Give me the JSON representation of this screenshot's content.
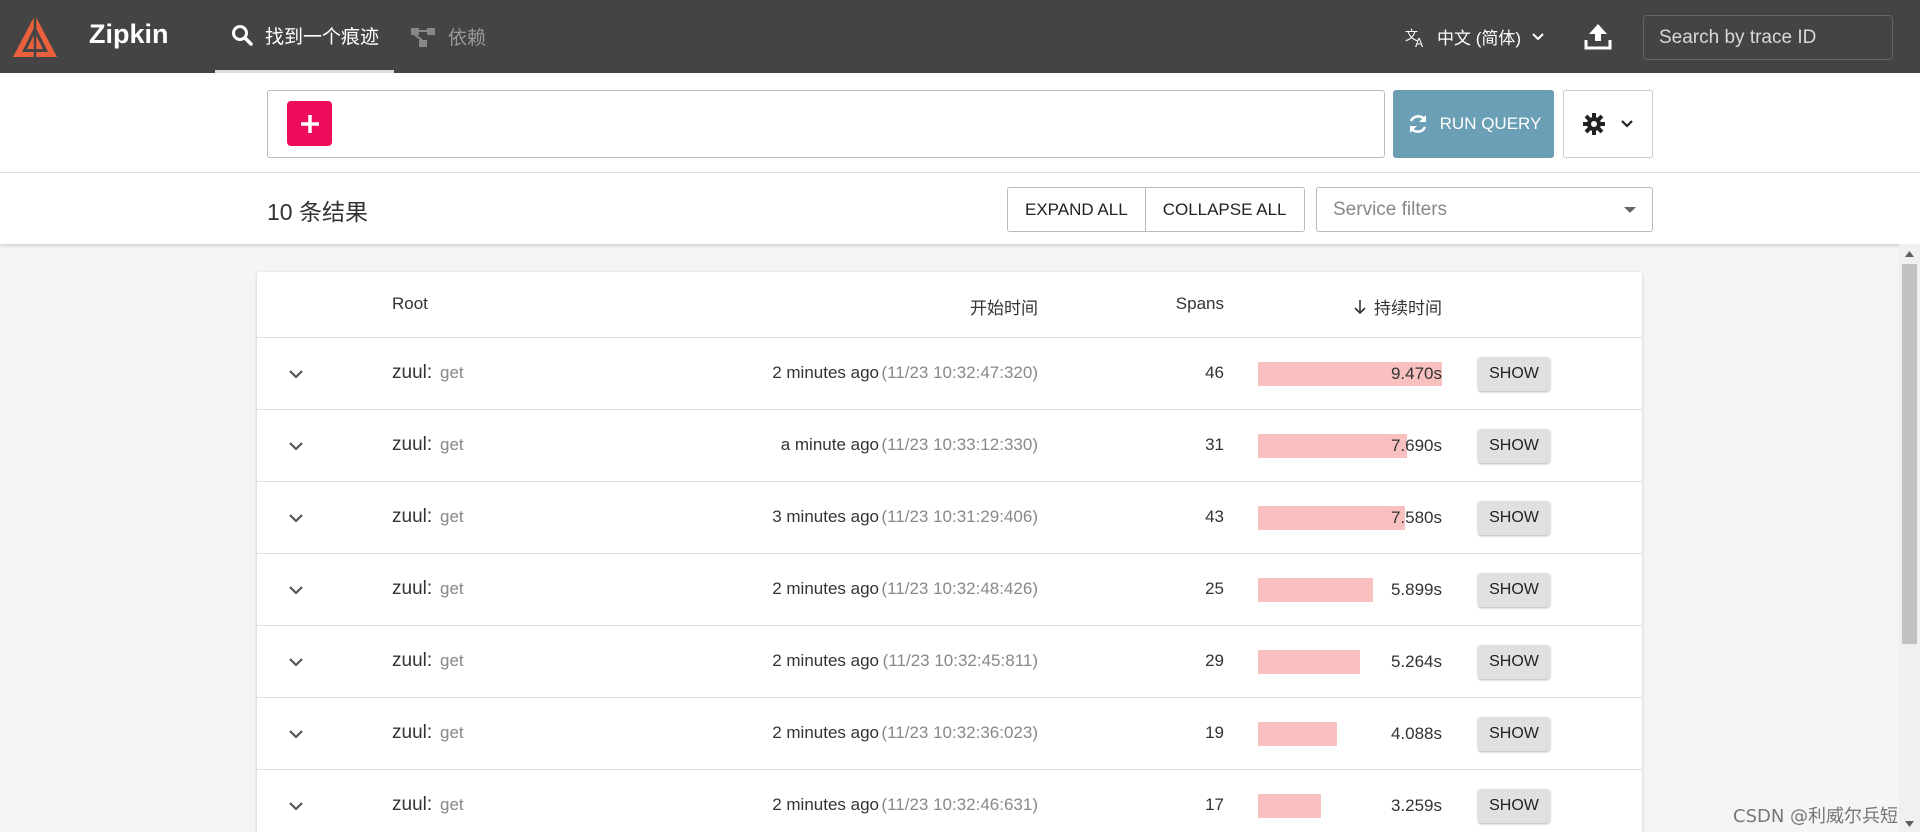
{
  "app": {
    "brand": "Zipkin"
  },
  "nav": {
    "tabs": [
      {
        "label": "找到一个痕迹",
        "icon": "search-icon",
        "active": true
      },
      {
        "label": "依赖",
        "icon": "dependencies-icon",
        "active": false
      }
    ],
    "language": "中文 (简体)",
    "trace_search_placeholder": "Search by trace ID"
  },
  "query": {
    "run_label": "RUN QUERY"
  },
  "results": {
    "count_label": "10 条结果",
    "expand_all": "EXPAND ALL",
    "collapse_all": "COLLAPSE ALL",
    "service_filter_placeholder": "Service filters"
  },
  "table": {
    "headers": {
      "root": "Root",
      "start_time": "开始时间",
      "spans": "Spans",
      "duration": "持续时间"
    },
    "show_label": "SHOW",
    "rows": [
      {
        "service": "zuul:",
        "operation": "get",
        "relative": "2 minutes ago",
        "absolute": "(11/23 10:32:47:320)",
        "spans": "46",
        "duration": "9.470s",
        "duration_ratio": 1.0
      },
      {
        "service": "zuul:",
        "operation": "get",
        "relative": "a minute ago",
        "absolute": "(11/23 10:33:12:330)",
        "spans": "31",
        "duration": "7.690s",
        "duration_ratio": 0.812
      },
      {
        "service": "zuul:",
        "operation": "get",
        "relative": "3 minutes ago",
        "absolute": "(11/23 10:31:29:406)",
        "spans": "43",
        "duration": "7.580s",
        "duration_ratio": 0.8
      },
      {
        "service": "zuul:",
        "operation": "get",
        "relative": "2 minutes ago",
        "absolute": "(11/23 10:32:48:426)",
        "spans": "25",
        "duration": "5.899s",
        "duration_ratio": 0.623
      },
      {
        "service": "zuul:",
        "operation": "get",
        "relative": "2 minutes ago",
        "absolute": "(11/23 10:32:45:811)",
        "spans": "29",
        "duration": "5.264s",
        "duration_ratio": 0.556
      },
      {
        "service": "zuul:",
        "operation": "get",
        "relative": "2 minutes ago",
        "absolute": "(11/23 10:32:36:023)",
        "spans": "19",
        "duration": "4.088s",
        "duration_ratio": 0.432
      },
      {
        "service": "zuul:",
        "operation": "get",
        "relative": "2 minutes ago",
        "absolute": "(11/23 10:32:46:631)",
        "spans": "17",
        "duration": "3.259s",
        "duration_ratio": 0.344
      }
    ]
  },
  "colors": {
    "topbar": "#444444",
    "add_button": "#ed0c5c",
    "run_button": "#6a9fb5",
    "duration_bar": "#f9c0c0"
  },
  "watermark": "CSDN @利威尔兵短"
}
